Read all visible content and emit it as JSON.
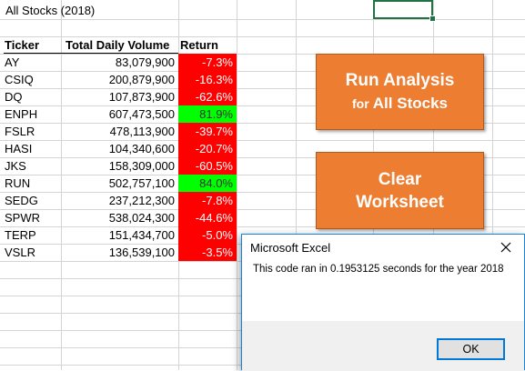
{
  "sheet": {
    "title": "All Stocks (2018)",
    "headers": {
      "ticker": "Ticker",
      "volume": "Total Daily Volume",
      "return": "Return"
    },
    "rows": [
      {
        "ticker": "AY",
        "volume": "83,079,900",
        "return": "-7.3%",
        "positive": false
      },
      {
        "ticker": "CSIQ",
        "volume": "200,879,900",
        "return": "-16.3%",
        "positive": false
      },
      {
        "ticker": "DQ",
        "volume": "107,873,900",
        "return": "-62.6%",
        "positive": false
      },
      {
        "ticker": "ENPH",
        "volume": "607,473,500",
        "return": "81.9%",
        "positive": true
      },
      {
        "ticker": "FSLR",
        "volume": "478,113,900",
        "return": "-39.7%",
        "positive": false
      },
      {
        "ticker": "HASI",
        "volume": "104,340,600",
        "return": "-20.7%",
        "positive": false
      },
      {
        "ticker": "JKS",
        "volume": "158,309,000",
        "return": "-60.5%",
        "positive": false
      },
      {
        "ticker": "RUN",
        "volume": "502,757,100",
        "return": "84.0%",
        "positive": true
      },
      {
        "ticker": "SEDG",
        "volume": "237,212,300",
        "return": "-7.8%",
        "positive": false
      },
      {
        "ticker": "SPWR",
        "volume": "538,024,300",
        "return": "-44.6%",
        "positive": false
      },
      {
        "ticker": "TERP",
        "volume": "151,434,700",
        "return": "-5.0%",
        "positive": false
      },
      {
        "ticker": "VSLR",
        "volume": "136,539,100",
        "return": "-3.5%",
        "positive": false
      }
    ]
  },
  "buttons": {
    "run": {
      "line1": "Run Analysis",
      "line2_prefix": "for",
      "line2_rest": "All Stocks"
    },
    "clear": {
      "line1": "Clear",
      "line2": "Worksheet"
    }
  },
  "dialog": {
    "title": "Microsoft Excel",
    "message": "This code ran in 0.1953125 seconds for the year 2018",
    "ok_label": "OK",
    "close_icon": "close-icon"
  },
  "colors": {
    "positive_fill": "#00ff00",
    "negative_fill": "#ff0000",
    "button_fill": "#ed7d31",
    "selection": "#217346",
    "dialog_accent": "#0078d7"
  }
}
